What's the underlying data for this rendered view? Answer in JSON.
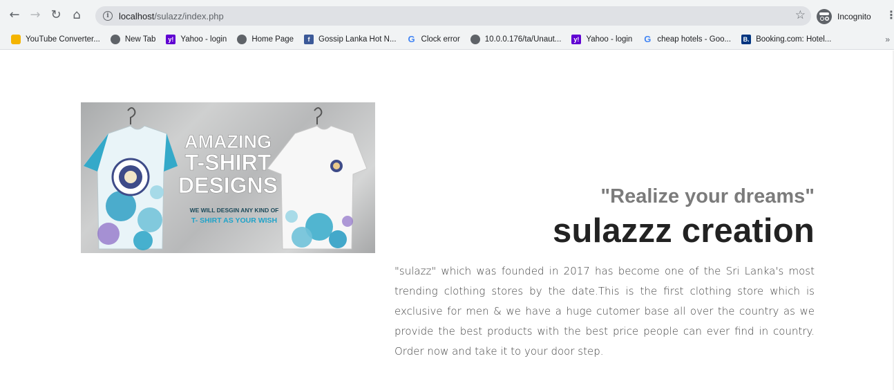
{
  "browser": {
    "url_host": "localhost",
    "url_path": "/sulazz/index.php",
    "profile_label": "Incognito",
    "bookmarks": [
      {
        "label": "YouTube Converter...",
        "icon": "youtube-converter-icon"
      },
      {
        "label": "New Tab",
        "icon": "globe-icon"
      },
      {
        "label": "Yahoo - login",
        "icon": "yahoo-icon"
      },
      {
        "label": "Home Page",
        "icon": "globe-icon"
      },
      {
        "label": "Gossip Lanka Hot N...",
        "icon": "facebook-icon"
      },
      {
        "label": "Clock error",
        "icon": "google-icon"
      },
      {
        "label": "10.0.0.176/ta/Unaut...",
        "icon": "globe-icon"
      },
      {
        "label": "Yahoo - login",
        "icon": "yahoo-icon"
      },
      {
        "label": "cheap hotels - Goo...",
        "icon": "google-icon"
      },
      {
        "label": "Booking.com: Hotel...",
        "icon": "booking-icon"
      }
    ],
    "more_bookmarks": "»"
  },
  "hero": {
    "line1": "AMAZING",
    "line2": "T-SHIRT",
    "line3": "DESIGNS",
    "sub1": "WE WILL DESGIN ANY KIND OF",
    "sub2": "T- SHIRT AS YOUR WISH"
  },
  "about": {
    "tagline": "\"Realize your dreams\"",
    "title": "sulazzz creation",
    "body": "\"sulazz\" which was founded in 2017 has become one of the Sri Lanka's most trending clothing stores by the date.This is the first clothing store which is exclusive for men & we have a huge cutomer base all over the country as we provide the best products with the best price people can ever find in country. Order now and take it to your door step."
  },
  "colors": {
    "title": "#222222",
    "tagline": "#7b7b7b",
    "shirt_accent": "#1fa3c9",
    "hero_text": "#ffffff"
  }
}
